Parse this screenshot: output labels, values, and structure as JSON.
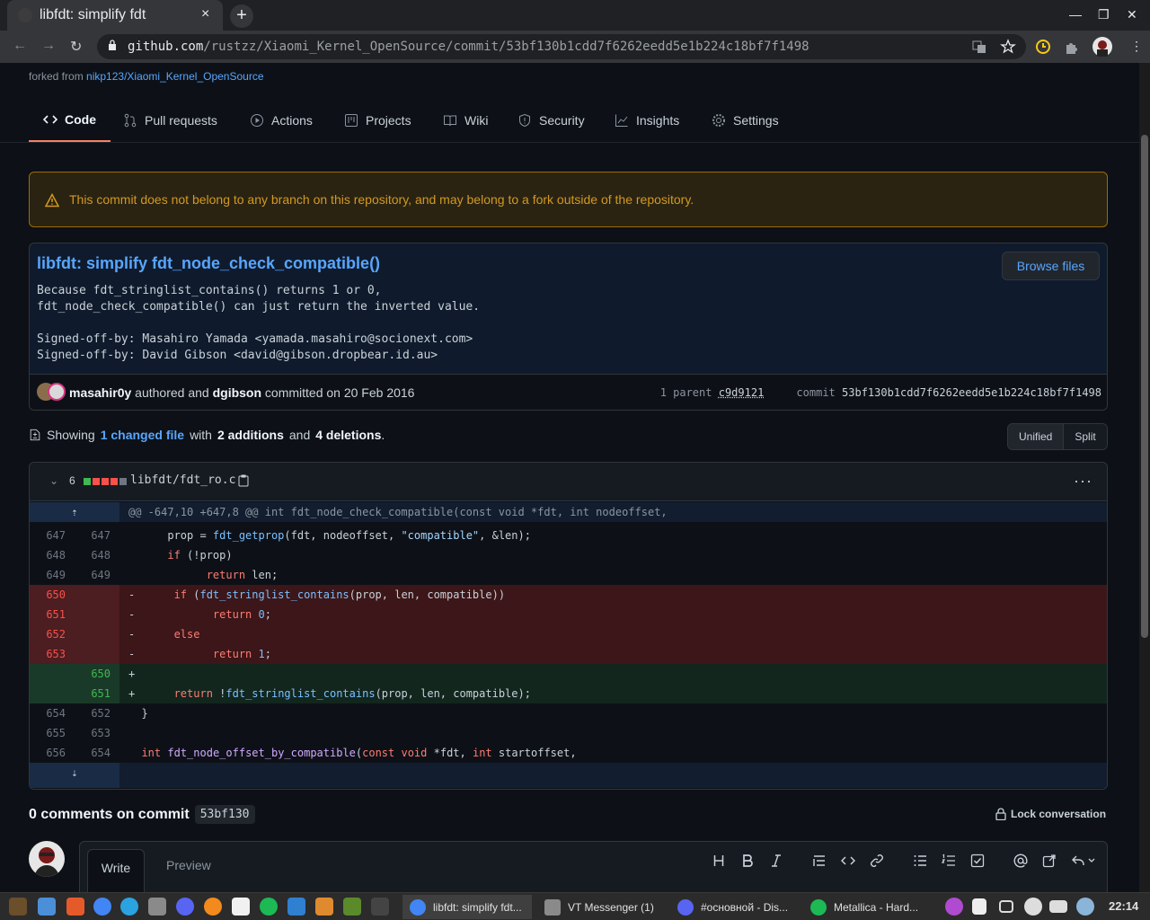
{
  "browser": {
    "tab_title": "libfdt: simplify fdt",
    "url_domain": "github.com",
    "url_path": "/rustzz/Xiaomi_Kernel_OpenSource/commit/53bf130b1cdd7f6262eedd5e1b224c18bf7f1498",
    "tab_close": "×",
    "new_tab": "+",
    "win_minimize": "—",
    "win_maximize": "❐",
    "win_close": "✕",
    "back": "←",
    "forward": "→",
    "reload": "↻"
  },
  "repo": {
    "forked_prefix": "forked from",
    "forked_link": "nikp123/Xiaomi_Kernel_OpenSource",
    "tabs": [
      "Code",
      "Pull requests",
      "Actions",
      "Projects",
      "Wiki",
      "Security",
      "Insights",
      "Settings"
    ]
  },
  "flash": {
    "message": "This commit does not belong to any branch on this repository, and may belong to a fork outside of the repository."
  },
  "commit": {
    "title": "libfdt: simplify fdt_node_check_compatible()",
    "browse_label": "Browse files",
    "body": "Because fdt_stringlist_contains() returns 1 or 0,\nfdt_node_check_compatible() can just return the inverted value.\n\nSigned-off-by: Masahiro Yamada <yamada.masahiro@socionext.com>\nSigned-off-by: David Gibson <david@gibson.dropbear.id.au>",
    "author": "masahir0y",
    "authored_text": "authored and",
    "committer": "dgibson",
    "committed_text": "committed on 20 Feb 2016",
    "parent_label": "1 parent",
    "parent_sha": "c9d9121",
    "commit_label": "commit",
    "sha": "53bf130b1cdd7f6262eedd5e1b224c18bf7f1498"
  },
  "summary": {
    "showing": "Showing",
    "changed": "1 changed file",
    "with": "with",
    "additions": "2 additions",
    "and": "and",
    "deletions": "4 deletions",
    "period": ".",
    "unified": "Unified",
    "split": "Split"
  },
  "diff": {
    "count": "6",
    "filename": "libfdt/fdt_ro.c",
    "chevron": "⌄",
    "dots": "···",
    "expand_up": "⇡",
    "expand_down": "⇣",
    "hunk": "@@ -647,10 +647,8 @@ int fdt_node_check_compatible(const void *fdt, int nodeoffset,",
    "lines": [
      {
        "type": "ctx",
        "old": "647",
        "new": "647",
        "html": "\tprop = <span class=\"fnc\">fdt_getprop</span>(fdt, nodeoffset, <span class=\"str\">\"compatible\"</span>, &amp;len);"
      },
      {
        "type": "ctx",
        "old": "648",
        "new": "648",
        "html": "\t<span class=\"kw\">if</span> (!prop)"
      },
      {
        "type": "ctx",
        "old": "649",
        "new": "649",
        "html": "\t\t<span class=\"kw\">return</span> len;"
      },
      {
        "type": "del",
        "old": "650",
        "new": "",
        "html": "-\t<span class=\"kw\">if</span> (<span class=\"fnc\">fdt_stringlist_contains</span>(prop, len, compatible))"
      },
      {
        "type": "del",
        "old": "651",
        "new": "",
        "html": "-\t\t<span class=\"kw\">return</span> <span class=\"num\">0</span>;"
      },
      {
        "type": "del",
        "old": "652",
        "new": "",
        "html": "-\t<span class=\"kw\">else</span>"
      },
      {
        "type": "del",
        "old": "653",
        "new": "",
        "html": "-\t\t<span class=\"kw\">return</span> <span class=\"num\">1</span>;"
      },
      {
        "type": "add",
        "old": "",
        "new": "650",
        "html": "+"
      },
      {
        "type": "add",
        "old": "",
        "new": "651",
        "html": "+\t<span class=\"kw\">return</span> !<span class=\"fnc\">fdt_stringlist_contains</span>(prop, len, compatible);"
      },
      {
        "type": "ctx",
        "old": "654",
        "new": "652",
        "html": "  }"
      },
      {
        "type": "ctx",
        "old": "655",
        "new": "653",
        "html": ""
      },
      {
        "type": "ctx",
        "old": "656",
        "new": "654",
        "html": "  <span class=\"kw\">int</span> <span class=\"fn\">fdt_node_offset_by_compatible</span>(<span class=\"kw\">const</span> <span class=\"kw\">void</span> *fdt, <span class=\"kw\">int</span> startoffset,"
      }
    ]
  },
  "comments": {
    "heading": "0 comments on commit",
    "sha": "53bf130",
    "lock_label": "Lock conversation",
    "write_tab": "Write",
    "preview_tab": "Preview"
  },
  "taskbar": {
    "windows": [
      "libfdt: simplify fdt...",
      "VT Messenger (1)",
      "#основной - Dis...",
      "Metallica - Hard..."
    ],
    "clock": "22:14"
  },
  "colors": {
    "accent": "#58a6ff",
    "warning": "#d29922",
    "deletion": "#f85149",
    "addition": "#3fb950"
  }
}
